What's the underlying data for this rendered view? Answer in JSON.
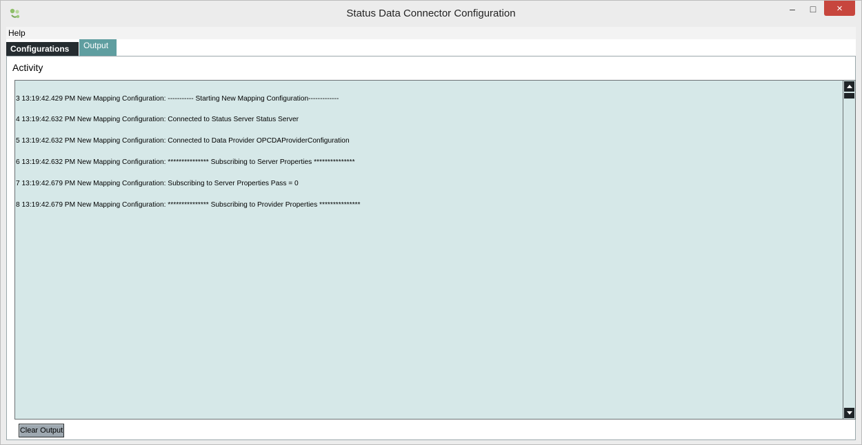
{
  "window": {
    "title": "Status Data Connector Configuration",
    "minimize": "–",
    "maximize": "□",
    "close": "×"
  },
  "menu": {
    "help_label": "Help"
  },
  "tabs": [
    {
      "label": "Configurations",
      "active": false
    },
    {
      "label": "Output",
      "active": true
    }
  ],
  "output": {
    "section_label": "Activity",
    "log_lines": [
      "3 13:19:42.429 PM New Mapping Configuration: ----------- Starting New Mapping Configuration-------------",
      "4 13:19:42.632 PM New Mapping Configuration: Connected to Status Server Status Server",
      "5 13:19:42.632 PM New Mapping Configuration: Connected to Data Provider OPCDAProviderConfiguration",
      "6 13:19:42.632 PM New Mapping Configuration: *************** Subscribing to Server Properties ***************",
      "7 13:19:42.679 PM New Mapping Configuration: Subscribing to Server Properties Pass = 0",
      "8 13:19:42.679 PM New Mapping Configuration: *************** Subscribing to Provider Properties ***************"
    ],
    "clear_button_label": "Clear Output"
  },
  "colors": {
    "log_background": "#d6e8e8",
    "tab_active": "#5f9ea0",
    "tab_inactive": "#252c30",
    "close_button": "#c7463d"
  }
}
